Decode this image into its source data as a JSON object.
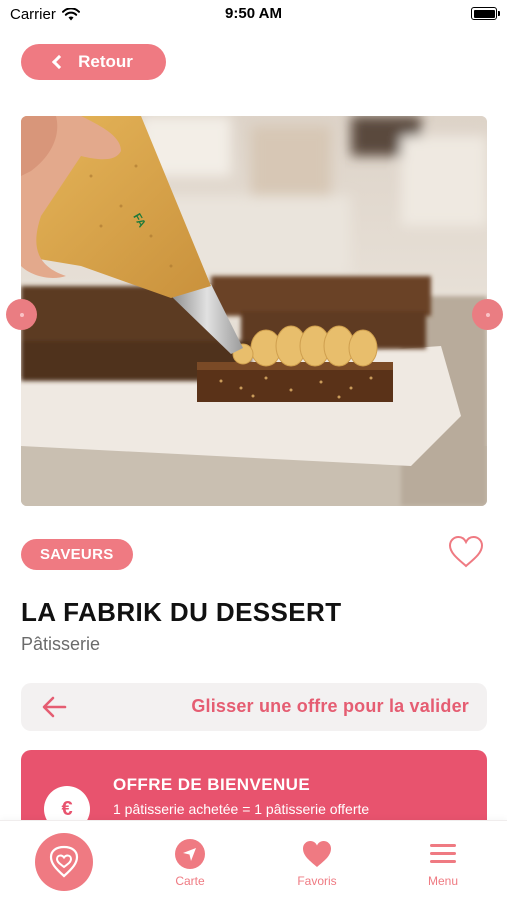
{
  "status_bar": {
    "carrier": "Carrier",
    "time": "9:50 AM"
  },
  "header": {
    "back_label": "Retour"
  },
  "carousel": {
    "image_description": "pastry-piping"
  },
  "place": {
    "category": "SAVEURS",
    "name": "LA FABRIK DU DESSERT",
    "type": "Pâtisserie"
  },
  "swipe": {
    "label": "Glisser une offre pour la valider"
  },
  "offer": {
    "icon": "€",
    "title": "OFFRE DE BIENVENUE",
    "description": "1 pâtisserie achetée = 1 pâtisserie offerte"
  },
  "tabs": [
    {
      "label": "Carte",
      "icon": "navigation-arrow-icon"
    },
    {
      "label": "Favoris",
      "icon": "heart-icon"
    },
    {
      "label": "Menu",
      "icon": "hamburger-icon"
    }
  ],
  "colors": {
    "accent": "#ef7a82",
    "offer": "#e8536e",
    "swipe_text": "#e55d72"
  }
}
